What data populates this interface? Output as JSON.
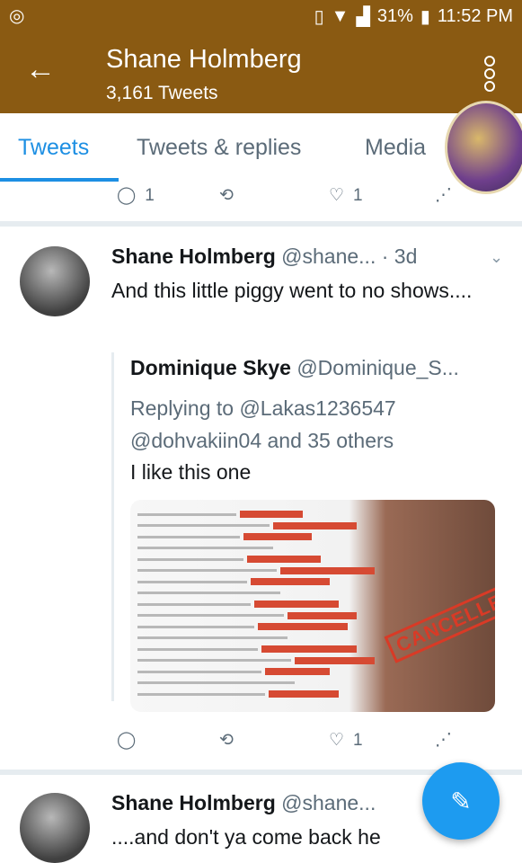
{
  "status": {
    "battery": "31%",
    "time": "11:52 PM"
  },
  "header": {
    "title": "Shane Holmberg",
    "subtitle": "3,161 Tweets"
  },
  "tabs": [
    {
      "label": "Tweets"
    },
    {
      "label": "Tweets & replies"
    },
    {
      "label": "Media"
    }
  ],
  "prev_tweet": {
    "reply_count": "1",
    "like_count": "1"
  },
  "tweet": {
    "name": "Shane Holmberg",
    "handle": "@shane...",
    "time": "· 3d",
    "text": "And this little piggy went to no shows....",
    "quote": {
      "name": "Dominique Skye",
      "handle": "@Dominique_S...",
      "reply_line1": "Replying to @Lakas1236547",
      "reply_line2": "@dohvakiin04 and 35 others",
      "text": "I like this one",
      "stamp": "CANCELLED"
    },
    "like_count": "1"
  },
  "next_tweet": {
    "name": "Shane Holmberg",
    "handle": "@shane...",
    "text": "....and don't ya come back he"
  },
  "colors": {
    "header": "#8a5a12",
    "accent": "#1d8fe3"
  }
}
